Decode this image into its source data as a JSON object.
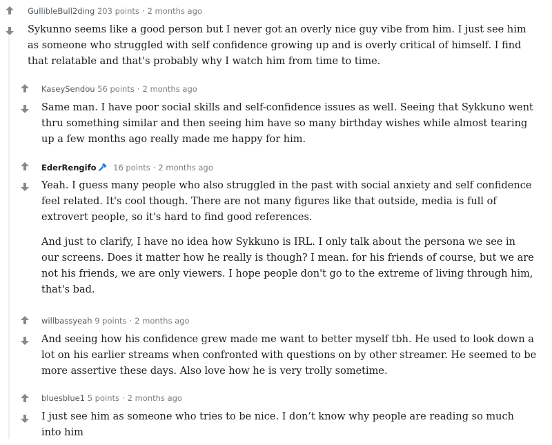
{
  "comments": [
    {
      "author": "GullibleBull2ding",
      "points": "203 points",
      "age": "2 months ago",
      "paragraphs": [
        "Sykunno seems like a good person but I never got an overly nice guy vibe from him. I just see him as someone who struggled with self confidence growing up and is overly critical of himself. I find that relatable and that's probably why I watch him from time to time."
      ]
    },
    {
      "author": "KaseySendou",
      "points": "56 points",
      "age": "2 months ago",
      "paragraphs": [
        "Same man. I have poor social skills and self-confidence issues as well. Seeing that Sykkuno went thru something similar and then seeing him have so many birthday wishes while almost tearing up a few months ago really made me happy for him."
      ]
    },
    {
      "author": "EderRengifo",
      "flair_icon": "microphone-icon",
      "points": "16 points",
      "age": "2 months ago",
      "paragraphs": [
        "Yeah. I guess many people who also struggled in the past with social anxiety and self confidence feel related. It's cool though. There are not many figures like that outside, media is full of extrovert people, so it's hard to find good references.",
        "And just to clarify, I have no idea how Sykkuno is IRL. I only talk about the persona we see in our screens. Does it matter how he really is though? I mean. for his friends of course, but we are not his friends, we are only viewers. I hope people don't go to the extreme of living through him, that's bad."
      ]
    },
    {
      "author": "willbassyeah",
      "points": "9 points",
      "age": "2 months ago",
      "paragraphs": [
        "And seeing how his confidence grew made me want to better myself tbh. He used to look down a lot on his earlier streams when confronted with questions on by other streamer. He seemed to be more assertive these days. Also love how he is very trolly sometime."
      ]
    },
    {
      "author": "bluesblue1",
      "points": "5 points",
      "age": "2 months ago",
      "paragraphs": [
        "I just see him as someone who tries to be nice. I don’t know why people are reading so much into him"
      ]
    }
  ],
  "separator": "·",
  "icons": {
    "upvote": "upvote-arrow-icon",
    "downvote": "downvote-arrow-icon"
  },
  "colors": {
    "arrow": "#878a8c",
    "flair": "#2f7fd1",
    "meta": "#7c7c7c"
  }
}
